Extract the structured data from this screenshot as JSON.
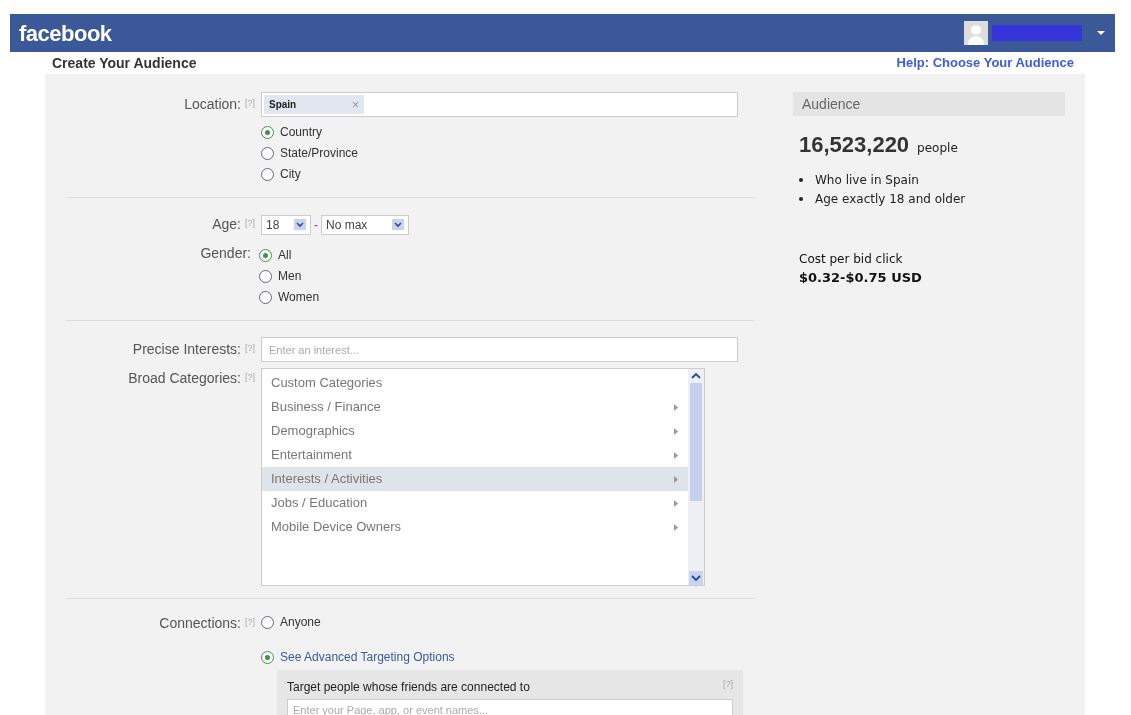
{
  "header": {
    "logo": "facebook"
  },
  "page_title": "Create Your Audience",
  "help_link": "Help: Choose Your Audience",
  "location": {
    "label": "Location:",
    "help": "[?]",
    "tokens": [
      {
        "text": "Spain",
        "remove": "×"
      }
    ],
    "options": [
      {
        "label": "Country",
        "selected": true
      },
      {
        "label": "State/Province",
        "selected": false
      },
      {
        "label": "City",
        "selected": false
      }
    ]
  },
  "age": {
    "label": "Age:",
    "help": "[?]",
    "min": "18",
    "separator": "-",
    "max": "No max"
  },
  "gender": {
    "label": "Gender:",
    "options": [
      {
        "label": "All",
        "selected": true
      },
      {
        "label": "Men",
        "selected": false
      },
      {
        "label": "Women",
        "selected": false
      }
    ]
  },
  "precise_interests": {
    "label": "Precise Interests:",
    "help": "[?]",
    "placeholder": "Enter an interest..."
  },
  "broad_categories": {
    "label": "Broad Categories:",
    "help": "[?]",
    "items": [
      {
        "label": "Custom Categories",
        "selected": false,
        "expandable": false
      },
      {
        "label": "Business / Finance",
        "selected": false,
        "expandable": true
      },
      {
        "label": "Demographics",
        "selected": false,
        "expandable": true
      },
      {
        "label": "Entertainment",
        "selected": false,
        "expandable": true
      },
      {
        "label": "Interests / Activities",
        "selected": true,
        "expandable": true
      },
      {
        "label": "Jobs / Education",
        "selected": false,
        "expandable": true
      },
      {
        "label": "Mobile Device Owners",
        "selected": false,
        "expandable": true
      }
    ]
  },
  "connections": {
    "label": "Connections:",
    "help": "[?]",
    "options": [
      {
        "label": "Anyone",
        "selected": false,
        "kind": "plain"
      },
      {
        "label": "See Advanced Targeting Options",
        "selected": true,
        "kind": "link"
      }
    ],
    "advanced": {
      "title": "Target people whose friends are connected to",
      "help": "[?]",
      "placeholder": "Enter your Page, app, or event names..."
    }
  },
  "audience": {
    "title": "Audience",
    "count": "16,523,220",
    "unit": "people",
    "criteria": [
      "Who live in Spain",
      "Age exactly 18 and older"
    ],
    "cost_label": "Cost per bid click",
    "cost": "$0.32-$0.75 USD"
  }
}
